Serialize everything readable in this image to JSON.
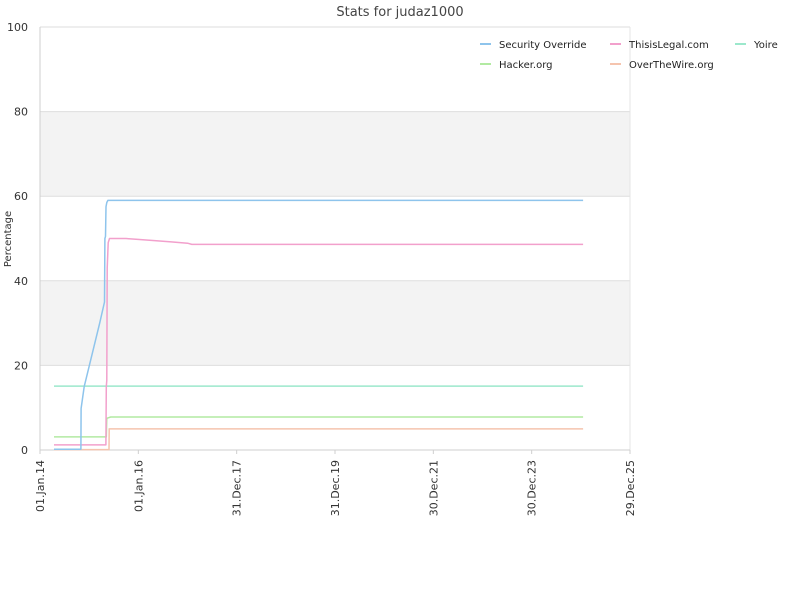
{
  "chart_data": {
    "type": "line",
    "title": "Stats for judaz1000",
    "ylabel": "Percentage",
    "xlabel": "",
    "ylim": [
      0,
      100
    ],
    "yticks": [
      0,
      20,
      40,
      60,
      80,
      100
    ],
    "x_axis_type": "date",
    "xlim": [
      "2014-01-01",
      "2025-12-29"
    ],
    "xticks": [
      {
        "date": "2014-01-01",
        "label": "01.Jan.14"
      },
      {
        "date": "2016-01-01",
        "label": "01.Jan.16"
      },
      {
        "date": "2017-12-31",
        "label": "31.Dec.17"
      },
      {
        "date": "2019-12-31",
        "label": "31.Dec.19"
      },
      {
        "date": "2021-12-30",
        "label": "30.Dec.21"
      },
      {
        "date": "2023-12-30",
        "label": "30.Dec.23"
      },
      {
        "date": "2025-12-29",
        "label": "29.Dec.25"
      }
    ],
    "grid": true,
    "legend_position": "top-right",
    "series": [
      {
        "name": "Security Override",
        "color": "#8ec4ec",
        "points": [
          [
            "2014-04-15",
            0.2
          ],
          [
            "2014-11-01",
            0.2
          ],
          [
            "2014-11-02",
            9.8
          ],
          [
            "2014-11-25",
            15
          ],
          [
            "2015-03-20",
            30
          ],
          [
            "2015-04-25",
            35
          ],
          [
            "2015-04-28",
            50
          ],
          [
            "2015-05-02",
            50.5
          ],
          [
            "2015-05-06",
            57.5
          ],
          [
            "2015-05-12",
            58.5
          ],
          [
            "2015-05-20",
            59
          ],
          [
            "2025-01-15",
            59
          ]
        ]
      },
      {
        "name": "ThisisLegal.com",
        "color": "#f2a0cc",
        "points": [
          [
            "2014-04-15",
            1.2
          ],
          [
            "2015-05-05",
            1.2
          ],
          [
            "2015-05-08",
            15
          ],
          [
            "2015-05-12",
            16.5
          ],
          [
            "2015-05-15",
            43
          ],
          [
            "2015-05-22",
            49
          ],
          [
            "2015-06-01",
            50
          ],
          [
            "2015-10-01",
            50
          ],
          [
            "2015-12-15",
            49.8
          ],
          [
            "2016-05-01",
            49.5
          ],
          [
            "2016-09-01",
            49.2
          ],
          [
            "2017-01-01",
            48.9
          ],
          [
            "2017-02-01",
            48.6
          ],
          [
            "2025-01-15",
            48.6
          ]
        ]
      },
      {
        "name": "Yoire",
        "color": "#9ce8cc",
        "points": [
          [
            "2014-04-15",
            15.1
          ],
          [
            "2025-01-15",
            15.1
          ]
        ]
      },
      {
        "name": "Hacker.org",
        "color": "#b2eaa2",
        "points": [
          [
            "2014-04-15",
            3.1
          ],
          [
            "2015-05-08",
            3.1
          ],
          [
            "2015-05-12",
            7.5
          ],
          [
            "2015-06-10",
            7.8
          ],
          [
            "2025-01-15",
            7.8
          ]
        ]
      },
      {
        "name": "OverTheWire.org",
        "color": "#f5c4ae",
        "points": [
          [
            "2014-04-15",
            0.1
          ],
          [
            "2015-05-28",
            0.1
          ],
          [
            "2015-05-30",
            5.0
          ],
          [
            "2025-01-15",
            5.0
          ]
        ]
      }
    ]
  }
}
